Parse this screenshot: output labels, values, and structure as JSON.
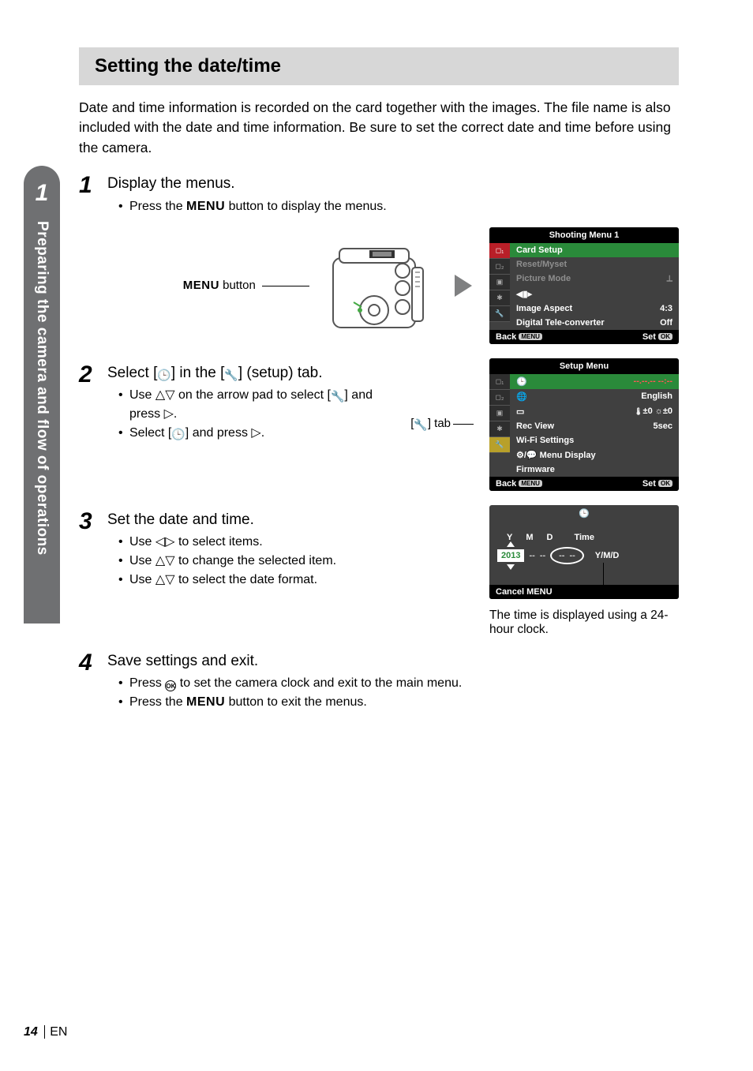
{
  "sidebar": {
    "chapter_number": "1",
    "chapter_title": "Preparing the camera and flow of operations"
  },
  "section": {
    "title": "Setting the date/time"
  },
  "intro": "Date and time information is recorded on the card together with the images. The file name is also included with the date and time information. Be sure to set the correct date and time before using the camera.",
  "step1": {
    "num": "1",
    "lead": "Display the menus.",
    "bullet1_a": "Press the ",
    "bullet1_menu": "MENU",
    "bullet1_b": " button to display the menus.",
    "menu_button_label_a": "MENU",
    "menu_button_label_b": " button"
  },
  "lcd1": {
    "title": "Shooting Menu 1",
    "r1": "Card Setup",
    "r2": "Reset/Myset",
    "r3": "Picture Mode",
    "r4_label": "Image Aspect",
    "r4_val": "4:3",
    "r5_label": "Digital Tele-converter",
    "r5_val": "Off",
    "back": "Back",
    "back_pill": "MENU",
    "set": "Set",
    "set_pill": "OK"
  },
  "step2": {
    "num": "2",
    "lead_a": "Select [",
    "lead_b": "] in the [",
    "lead_c": "] (setup) tab.",
    "b1_a": "Use ",
    "b1_b": " on the arrow pad to select [",
    "b1_c": "] and press ",
    "b2_a": "Select [",
    "b2_b": "] and press ",
    "tab_label_a": "[",
    "tab_label_b": "] tab"
  },
  "lcd2": {
    "title": "Setup Menu",
    "r1_val": "--.--.-- --:--",
    "r2_val": "English",
    "r3_val": "±0 ☼±0",
    "r4_label": "Rec View",
    "r4_val": "5sec",
    "r5": "Wi-Fi Settings",
    "r6": "/💬 Menu Display",
    "r7": "Firmware",
    "back": "Back",
    "back_pill": "MENU",
    "set": "Set",
    "set_pill": "OK"
  },
  "step3": {
    "num": "3",
    "lead": "Set the date and time.",
    "b1_a": "Use ",
    "b1_b": " to select items.",
    "b2_a": "Use ",
    "b2_b": " to change the selected item.",
    "b3_a": "Use ",
    "b3_b": " to select the date format."
  },
  "lcd3": {
    "hY": "Y",
    "hM": "M",
    "hD": "D",
    "hTime": "Time",
    "year": "2013",
    "dash": "--",
    "fmt": "Y/M/D",
    "cancel": "Cancel",
    "cancel_pill": "MENU",
    "caption": "The time is displayed using a 24-hour clock."
  },
  "step4": {
    "num": "4",
    "lead": "Save settings and exit.",
    "b1_a": "Press ",
    "b1_b": " to set the camera clock and exit to the main menu.",
    "b2_a": "Press the ",
    "b2_menu": "MENU",
    "b2_b": " button to exit the menus."
  },
  "footer": {
    "page": "14",
    "lang": "EN"
  }
}
